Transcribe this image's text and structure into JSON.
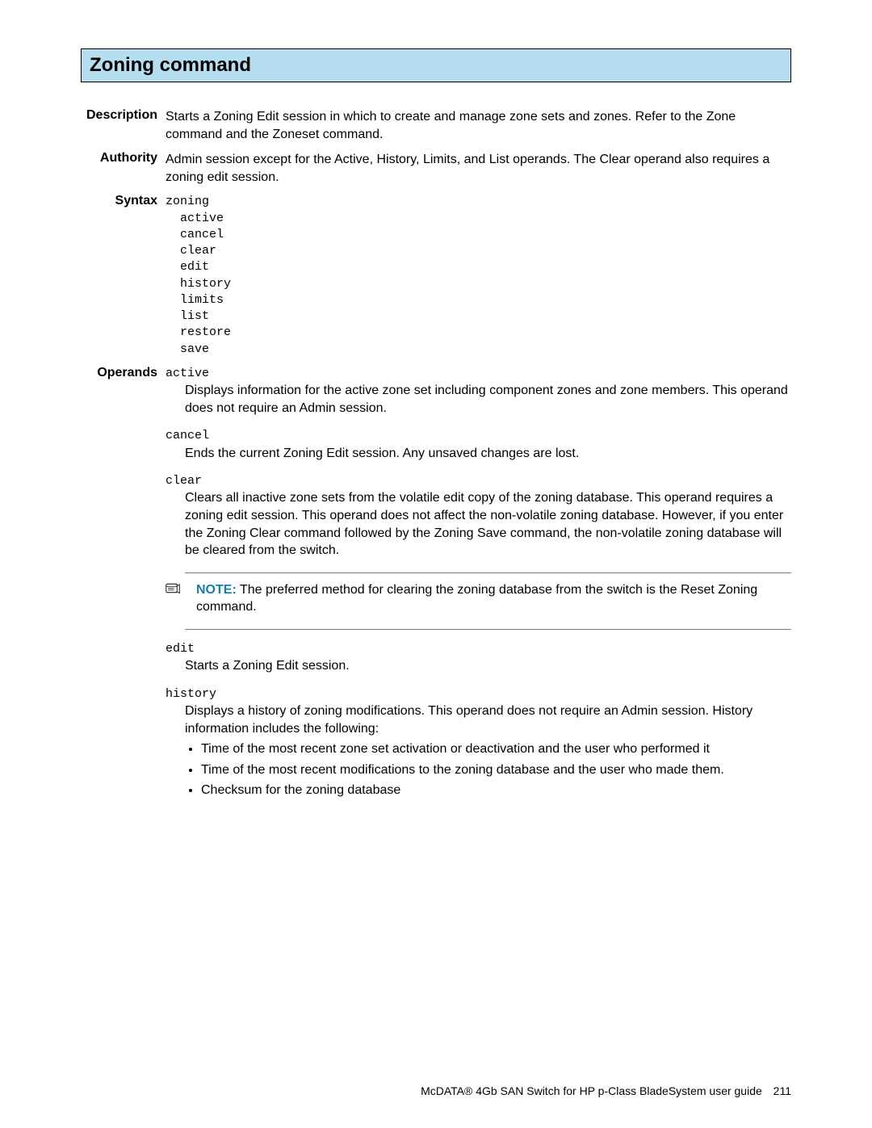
{
  "title": "Zoning command",
  "sections": {
    "description": {
      "label": "Description",
      "text": "Starts a Zoning Edit session in which to create and manage zone sets and zones. Refer to the Zone command and the Zoneset command."
    },
    "authority": {
      "label": "Authority",
      "text": "Admin session except for the Active, History, Limits, and List operands. The Clear operand also requires a zoning edit session."
    },
    "syntax": {
      "label": "Syntax",
      "command": "zoning",
      "subs": [
        "active",
        "cancel",
        "clear",
        "edit",
        "history",
        "limits",
        "list",
        "restore",
        "save"
      ]
    },
    "operands": {
      "label": "Operands",
      "items": [
        {
          "name": "active",
          "desc": "Displays information for the active zone set including component zones and zone members. This operand does not require an Admin session."
        },
        {
          "name": "cancel",
          "desc": "Ends the current Zoning Edit session. Any unsaved changes are lost."
        },
        {
          "name": "clear",
          "desc": "Clears all inactive zone sets from the volatile edit copy of the zoning database. This operand requires a zoning edit session. This operand does not affect the non-volatile zoning database. However, if you enter the Zoning Clear command followed by the Zoning Save command, the non-volatile zoning database will be cleared from the switch."
        },
        {
          "name": "edit",
          "desc": "Starts a Zoning Edit session."
        },
        {
          "name": "history",
          "desc": "Displays a history of zoning modifications. This operand does not require an Admin session. History information includes the following:",
          "bullets": [
            "Time of the most recent zone set activation or deactivation and the user who performed it",
            "Time of the most recent modifications to the zoning database and the user who made them.",
            "Checksum for the zoning database"
          ]
        }
      ]
    }
  },
  "note": {
    "label": "NOTE:",
    "text": "The preferred method for clearing the zoning database from the switch is the Reset Zoning command."
  },
  "footer": {
    "text": "McDATA® 4Gb SAN Switch for HP p-Class BladeSystem user guide",
    "page": "211"
  }
}
